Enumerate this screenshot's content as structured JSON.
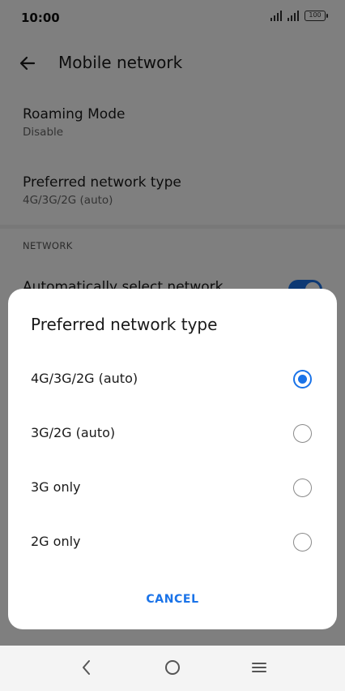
{
  "status_bar": {
    "time": "10:00",
    "battery": "100",
    "signal_icons": [
      "signal-icon",
      "signal-icon"
    ]
  },
  "app_bar": {
    "back_icon": "arrow-left-icon",
    "title": "Mobile network"
  },
  "settings": [
    {
      "title": "Roaming Mode",
      "subtitle": "Disable"
    },
    {
      "title": "Preferred network type",
      "subtitle": "4G/3G/2G (auto)"
    }
  ],
  "network_section": {
    "label": "NETWORK",
    "auto_select_label": "Automatically select network",
    "auto_select_on": true
  },
  "dialog": {
    "title": "Preferred network type",
    "options": [
      {
        "label": "4G/3G/2G (auto)",
        "selected": true
      },
      {
        "label": "3G/2G (auto)",
        "selected": false
      },
      {
        "label": "3G only",
        "selected": false
      },
      {
        "label": "2G only",
        "selected": false
      }
    ],
    "cancel_label": "CANCEL"
  },
  "nav_bar": {
    "icons": [
      "back-triangle-icon",
      "home-circle-icon",
      "menu-icon"
    ]
  },
  "colors": {
    "accent": "#1a73e8",
    "scrim": "rgba(0,0,0,0.5)"
  }
}
